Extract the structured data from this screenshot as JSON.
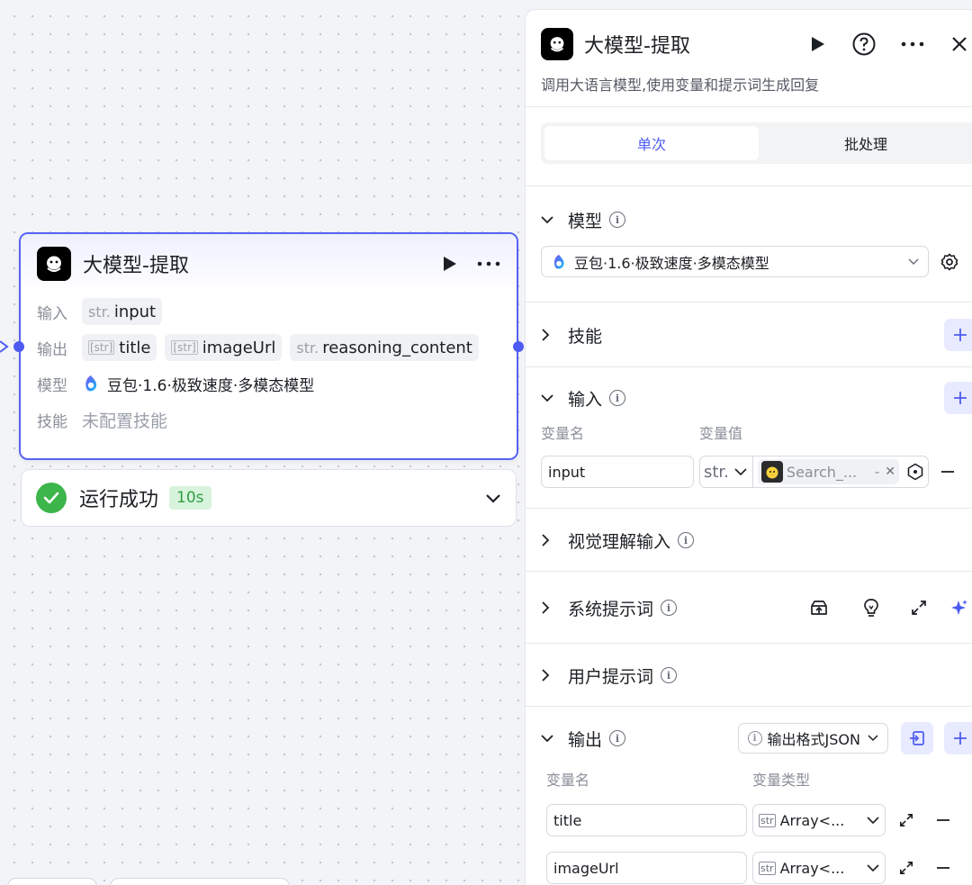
{
  "node": {
    "title": "大模型-提取",
    "input_label": "输入",
    "input_chip": {
      "prefix": "str.",
      "name": "input"
    },
    "output_label": "输出",
    "outputs": [
      {
        "prefix": "[str]",
        "name": "title"
      },
      {
        "prefix": "[str]",
        "name": "imageUrl"
      },
      {
        "prefix": "str.",
        "name": "reasoning_content"
      }
    ],
    "model_label": "模型",
    "model_value": "豆包·1.6·极致速度·多模态模型",
    "skill_label": "技能",
    "skill_value": "未配置技能"
  },
  "result": {
    "status": "运行成功",
    "duration": "10s"
  },
  "panel": {
    "title": "大模型-提取",
    "description": "调用大语言模型,使用变量和提示词生成回复",
    "tabs": [
      "单次",
      "批处理"
    ],
    "model_section": {
      "title": "模型",
      "selected": "豆包·1.6·极致速度·多模态模型"
    },
    "skills_section": {
      "title": "技能"
    },
    "input_section": {
      "title": "输入",
      "col_name": "变量名",
      "col_value": "变量值",
      "row": {
        "name": "input",
        "type": "str.",
        "ref": "Search_...",
        "ref_suffix": "-"
      }
    },
    "vision_section": {
      "title": "视觉理解输入"
    },
    "system_prompt_section": {
      "title": "系统提示词"
    },
    "user_prompt_section": {
      "title": "用户提示词"
    },
    "output_section": {
      "title": "输出",
      "format": "输出格式JSON",
      "col_name": "变量名",
      "col_type": "变量类型",
      "rows": [
        {
          "name": "title",
          "type": "Array<..."
        },
        {
          "name": "imageUrl",
          "type": "Array<..."
        }
      ]
    }
  },
  "colors": {
    "accent": "#4e5bf2",
    "success": "#3cb54a",
    "node_border": "#5662f6"
  }
}
